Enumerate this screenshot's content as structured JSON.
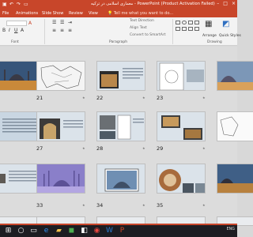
{
  "window": {
    "title": "معماری اسلامی در ترکیه - PowerPoint (Product Activation Failed)",
    "controls": [
      "minimize-icon",
      "restore-icon",
      "close-icon"
    ]
  },
  "tabs": [
    "File",
    "Animations",
    "Slide Show",
    "Review",
    "View"
  ],
  "tellme": "Tell me what you want to do...",
  "ribbon": {
    "text_direction": "Text Direction",
    "align_text": "Align Text",
    "convert_smartart": "Convert to SmartArt",
    "arrange": "Arrange",
    "quick_styles": "Quick Styles",
    "groups": [
      "Font",
      "Paragraph",
      "Drawing"
    ]
  },
  "slides": [
    {
      "num": "",
      "img": "mosque-dusk"
    },
    {
      "num": "21",
      "img": "map"
    },
    {
      "num": "22",
      "img": "text-photo"
    },
    {
      "num": "23",
      "img": "plan-drawing"
    },
    {
      "num": "",
      "img": "mosque-blue"
    },
    {
      "num": "",
      "img": "text-blue"
    },
    {
      "num": "27",
      "img": "interior"
    },
    {
      "num": "28",
      "img": "text-photo-plan"
    },
    {
      "num": "29",
      "img": "two-photos"
    },
    {
      "num": "",
      "img": "map-white"
    },
    {
      "num": "",
      "img": "text-small"
    },
    {
      "num": "33",
      "img": "purple-mosque"
    },
    {
      "num": "34",
      "img": "blue-mosque-framed"
    },
    {
      "num": "35",
      "img": "ornament"
    },
    {
      "num": "",
      "img": "mosque-dusk2"
    }
  ],
  "status": {
    "time": "",
    "lang": "ENG"
  },
  "colors": {
    "accent": "#c8462a",
    "ribbon_bg": "#f3f3f3",
    "canvas_bg": "#dcdcdc"
  }
}
